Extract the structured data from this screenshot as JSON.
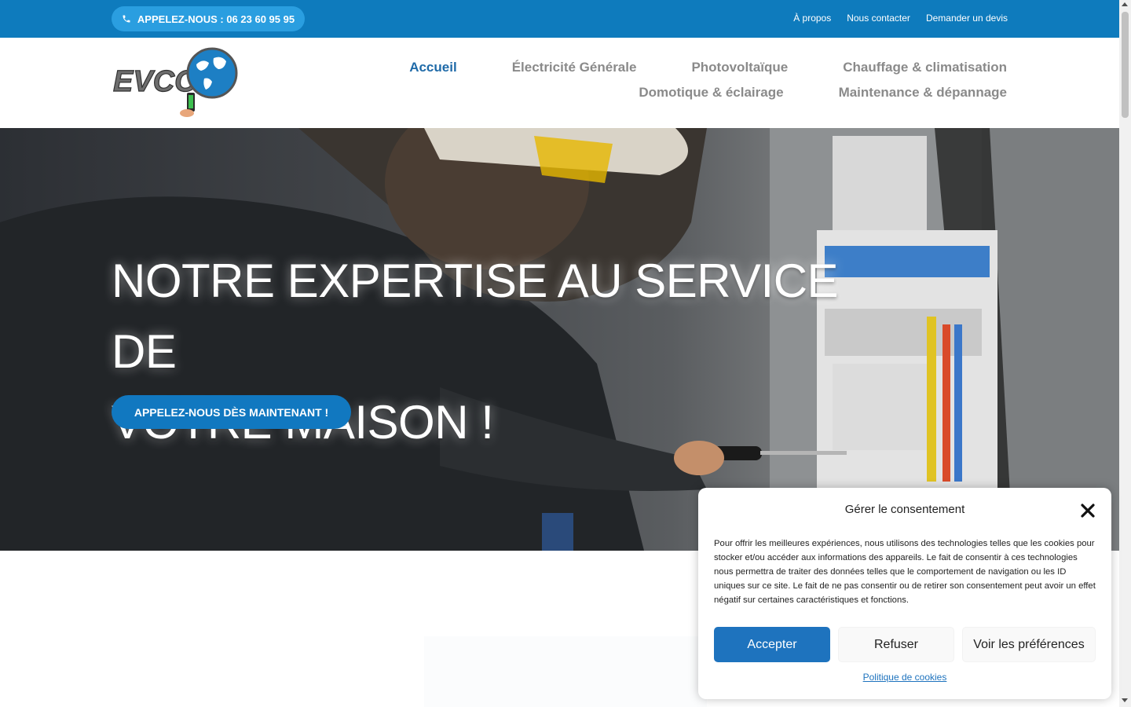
{
  "topbar": {
    "call_button": "APPELEZ-NOUS : 06 23 60 95 95",
    "links": [
      "À propos",
      "Nous contacter",
      "Demander un devis"
    ]
  },
  "header": {
    "logo_text": "EVCOM",
    "nav_row1": [
      "Accueil",
      "Électricité Générale",
      "Photovoltaïque",
      "Chauffage & climatisation"
    ],
    "nav_row2": [
      "Domotique & éclairage",
      "Maintenance & dépannage"
    ],
    "active_item": "Accueil"
  },
  "hero": {
    "title_line1": "NOTRE EXPERTISE AU SERVICE DE",
    "title_line2": "VOTRE MAISON !",
    "cta": "APPELEZ-NOUS DÈS MAINTENANT !"
  },
  "consent": {
    "title": "Gérer le consentement",
    "text": "Pour offrir les meilleures expériences, nous utilisons des technologies telles que les cookies pour stocker et/ou accéder aux informations des appareils. Le fait de consentir à ces technologies nous permettra de traiter des données telles que le comportement de navigation ou les ID uniques sur ce site. Le fait de ne pas consentir ou de retirer son consentement peut avoir un effet négatif sur certaines caractéristiques et fonctions.",
    "accept": "Accepter",
    "refuse": "Refuser",
    "preferences": "Voir les préférences",
    "policy_link": "Politique de cookies"
  },
  "colors": {
    "topbar": "#0e7bbd",
    "accent": "#1e73be",
    "nav_active": "#1f6aa8",
    "nav_text": "#8a8a8a"
  }
}
